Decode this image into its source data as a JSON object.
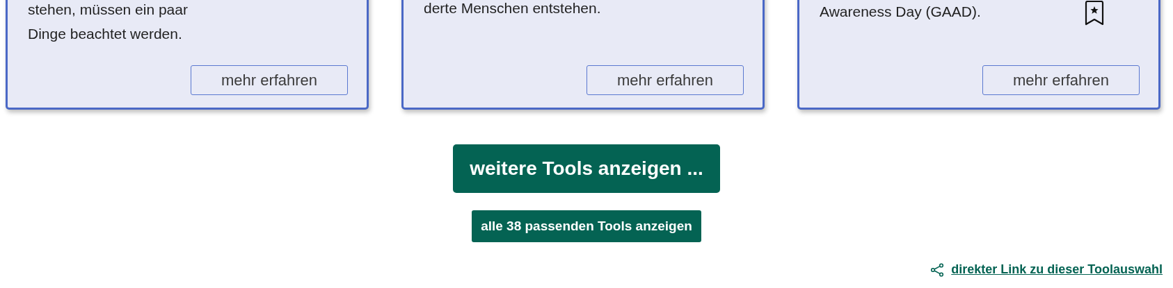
{
  "cards": [
    {
      "lines": [
        "stehen, müssen ein paar",
        "Dinge beachtet werden."
      ],
      "bookmarked": false,
      "button": "mehr erfahren"
    },
    {
      "lines": [
        "derte Menschen entstehen."
      ],
      "bookmarked": false,
      "button": "mehr erfahren"
    },
    {
      "lines": [
        "Awareness Day (GAAD)."
      ],
      "bookmarked": true,
      "button": "mehr erfahren"
    }
  ],
  "more_button": "weitere Tools anzeigen ...",
  "all_button": "alle 38 passenden Tools anzeigen",
  "share_link": "direkter Link zu dieser Toolauswahl"
}
